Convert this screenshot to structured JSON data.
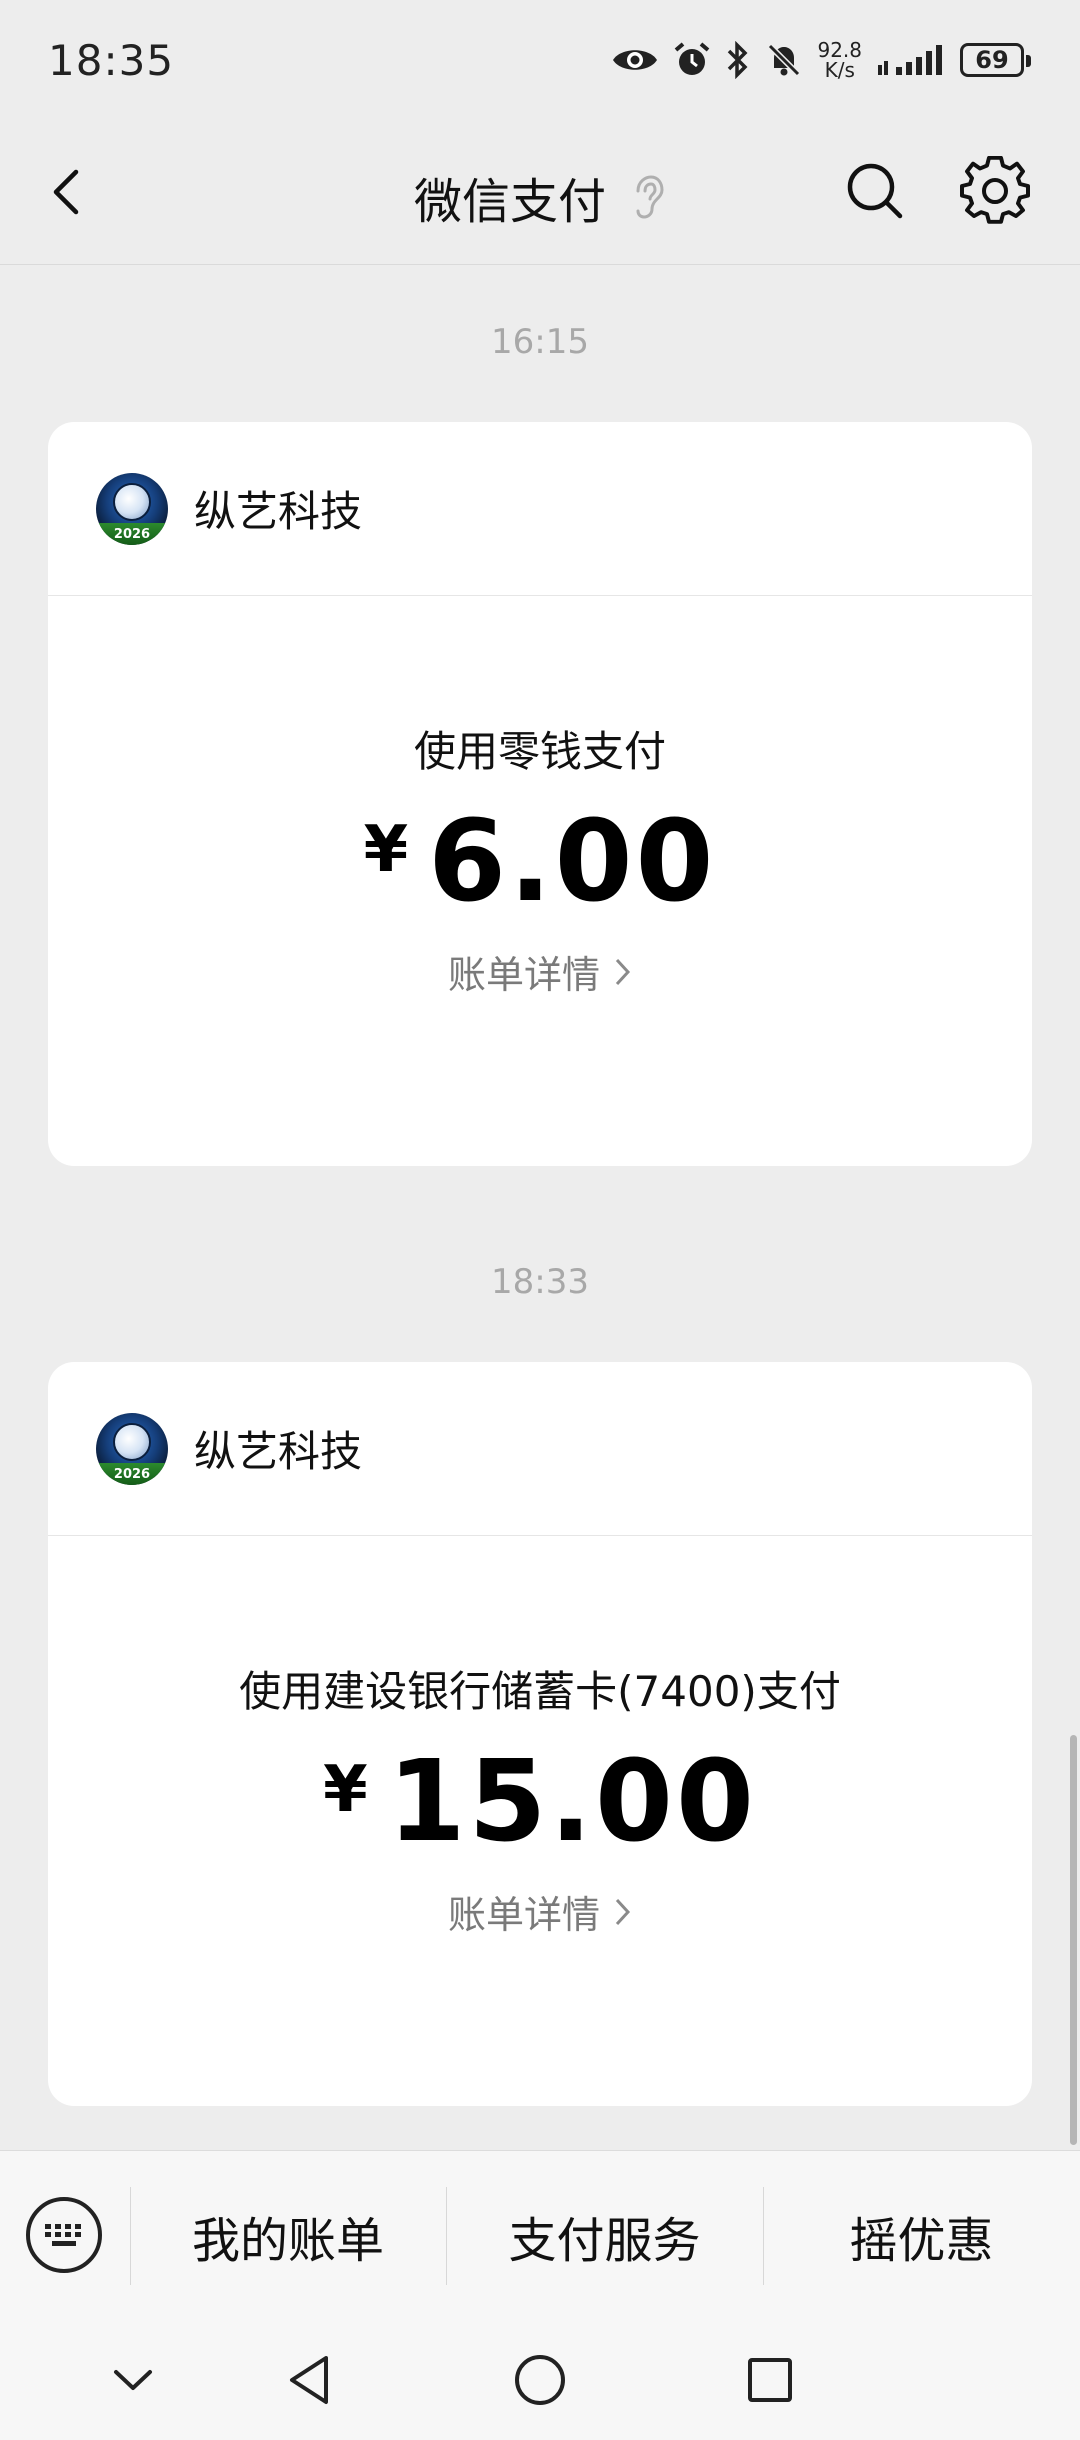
{
  "status_bar": {
    "time": "18:35",
    "net_speed_value": "92.8",
    "net_speed_unit": "K/s",
    "battery": "69",
    "icons": [
      "eye-icon",
      "alarm-icon",
      "bluetooth-icon",
      "mute-icon",
      "signal-icon"
    ]
  },
  "nav": {
    "title": "微信支付",
    "icons": [
      "back-icon",
      "ear-icon",
      "search-icon",
      "gear-icon"
    ]
  },
  "messages": [
    {
      "time": "16:15",
      "merchant": "纵艺科技",
      "avatar_year": "2026",
      "pay_method": "使用零钱支付",
      "currency": "¥",
      "amount": "6.00",
      "link": "账单详情"
    },
    {
      "time": "18:33",
      "merchant": "纵艺科技",
      "avatar_year": "2026",
      "pay_method": "使用建设银行储蓄卡(7400)支付",
      "currency": "¥",
      "amount": "15.00",
      "link": "账单详情"
    }
  ],
  "bottom_menu": {
    "items": [
      "我的账单",
      "支付服务",
      "摇优惠"
    ]
  },
  "system_nav": [
    "collapse-icon",
    "back-triangle-icon",
    "home-circle-icon",
    "recents-square-icon"
  ]
}
